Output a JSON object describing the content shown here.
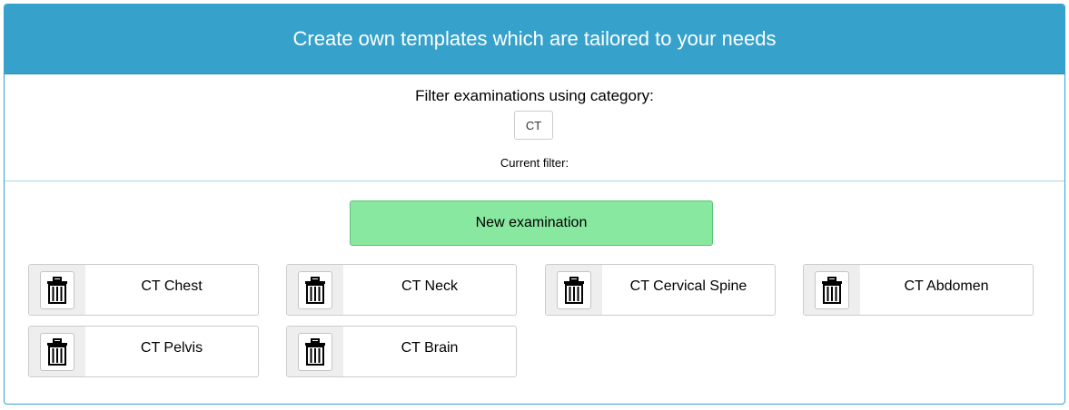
{
  "header": {
    "title": "Create own templates which are tailored to your needs"
  },
  "filter": {
    "title": "Filter examinations using category:",
    "category_button": "CT",
    "current_filter_label": "Current filter:"
  },
  "actions": {
    "new_examination": "New examination"
  },
  "examinations": [
    {
      "label": "CT Chest"
    },
    {
      "label": "CT Neck"
    },
    {
      "label": "CT Cervical Spine"
    },
    {
      "label": "CT Abdomen"
    },
    {
      "label": "CT Pelvis"
    },
    {
      "label": "CT Brain"
    }
  ],
  "icons": {
    "delete": "trash-icon"
  },
  "colors": {
    "header_bg": "#36a2cb",
    "new_button_bg": "#88e8a0"
  }
}
